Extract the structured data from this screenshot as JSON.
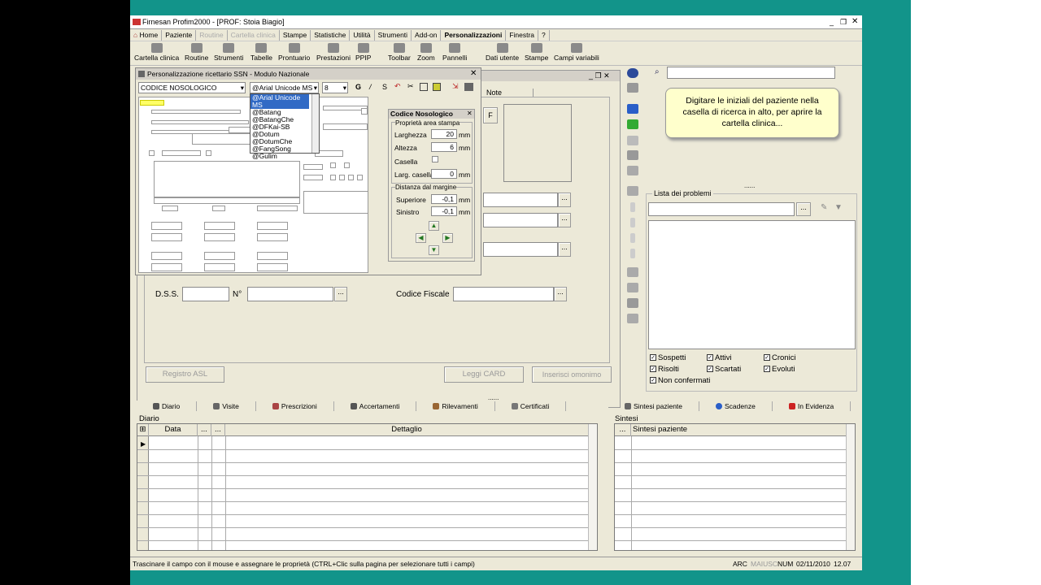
{
  "window": {
    "title": "Firnesan Profim2000 - [PROF: Stoia Biagio]",
    "controls": [
      "_",
      "❐",
      "✕"
    ]
  },
  "menu": [
    "Home",
    "Paziente",
    "Routine",
    "Cartella clinica",
    "Stampe",
    "Statistiche",
    "Utilità",
    "Strumenti",
    "Add-on",
    "Personalizzazioni",
    "Finestra",
    "?"
  ],
  "toolbar": [
    "Cartella clinica",
    "Routine",
    "Strumenti",
    "Tabelle",
    "Prontuario",
    "Prestazioni",
    "PPIP",
    "Toolbar",
    "Zoom",
    "Pannelli",
    "Dati utente",
    "Stampe",
    "Campi variabili"
  ],
  "search": {
    "placeholder": ""
  },
  "tooltip": "Digitare le iniziali del paziente nella casella di ricerca in alto, per aprire la cartella clinica...",
  "dialog": {
    "title": "Personalizzazione ricettario SSN - Modulo Nazionale",
    "field_select": "CODICE NOSOLOGICO",
    "font_select": "@Arial Unicode MS",
    "size_select": "8",
    "fonts": [
      "@Arial Unicode MS",
      "@Batang",
      "@BatangChe",
      "@DFKai-SB",
      "@Dotum",
      "@DotumChe",
      "@FangSong",
      "@Gulim"
    ],
    "prop": {
      "title": "Codice Nosologico",
      "group1": "Proprietà area stampa",
      "larghezza_label": "Larghezza",
      "larghezza": "20",
      "altezza_label": "Altezza",
      "altezza": "6",
      "casella_label": "Casella",
      "larg_casella_label": "Larg. casella",
      "larg_casella": "0",
      "unit": "mm",
      "group2": "Distanza dal margine",
      "superiore_label": "Superiore",
      "superiore": "-0,1",
      "sinistro_label": "Sinistro",
      "sinistro": "-0,1"
    }
  },
  "form": {
    "note_label": "Note",
    "dss": "D.S.S.",
    "n": "N°",
    "cf": "Codice Fiscale",
    "registro": "Registro ASL",
    "leggi": "Leggi CARD",
    "inserisci": "Inserisci omonimo",
    "ellipsis": "..."
  },
  "problems": {
    "title": "Lista dei problemi",
    "checks": [
      "Sospetti",
      "Attivi",
      "Cronici",
      "Risolti",
      "Scartati",
      "Evoluti",
      "Non confermati"
    ]
  },
  "bottom_tabs": [
    "Diario",
    "Visite",
    "Prescrizioni",
    "Accertamenti",
    "Rilevamenti",
    "Certificati"
  ],
  "right_tabs": [
    "Sintesi paziente",
    "Scadenze",
    "In Evidenza"
  ],
  "diario": {
    "title": "Diario",
    "cols": [
      "Data",
      "...",
      "...",
      "Dettaglio"
    ]
  },
  "sintesi": {
    "title": "Sintesi",
    "cols": [
      "...",
      "Sintesi paziente"
    ]
  },
  "status": {
    "message": "Trascinare il campo con il mouse e assegnare le proprietà (CTRL+Clic sulla pagina per selezionare tutti i campi)",
    "arc": "ARC",
    "maiusc": "MAIUSC",
    "num": "NUM",
    "date": "02/11/2010",
    "time": "12.07"
  }
}
